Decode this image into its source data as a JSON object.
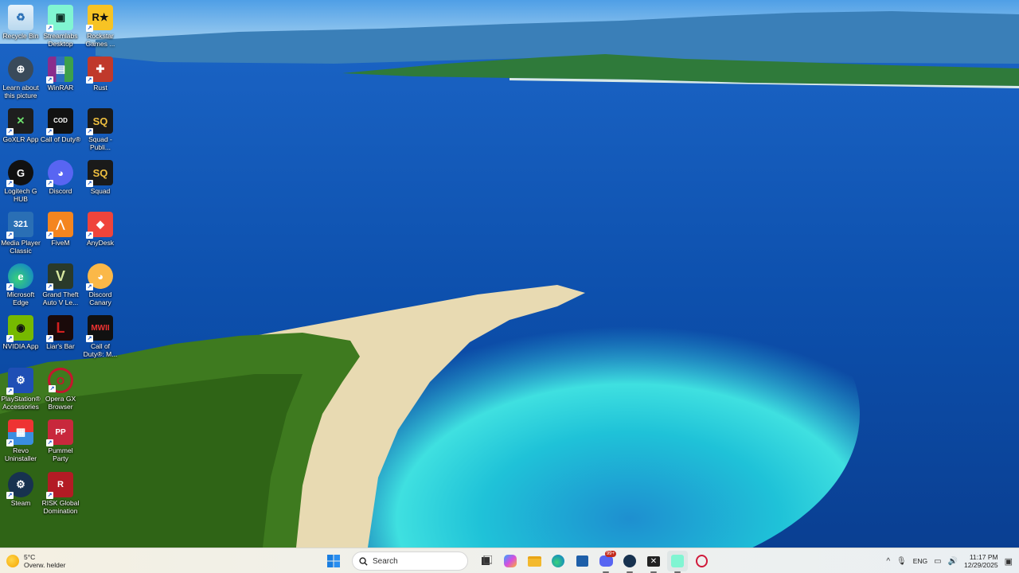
{
  "desktop": {
    "icons": [
      {
        "label": "Recycle Bin",
        "icon": "recycle-bin-icon"
      },
      {
        "label": "Streamlabs Desktop",
        "icon": "streamlabs-icon"
      },
      {
        "label": "Rockstar Games ...",
        "icon": "rockstar-icon"
      },
      {
        "label": "Learn about this picture",
        "icon": "learn-picture-icon"
      },
      {
        "label": "WinRAR",
        "icon": "winrar-icon"
      },
      {
        "label": "Rust",
        "icon": "rust-icon"
      },
      {
        "label": "GoXLR App",
        "icon": "goxlr-icon"
      },
      {
        "label": "Call of Duty®",
        "icon": "call-of-duty-icon"
      },
      {
        "label": "Squad - Publi...",
        "icon": "squad-public-icon"
      },
      {
        "label": "Logitech G HUB",
        "icon": "logitech-ghub-icon"
      },
      {
        "label": "Discord",
        "icon": "discord-icon"
      },
      {
        "label": "Squad",
        "icon": "squad-icon"
      },
      {
        "label": "Media Player Classic",
        "icon": "media-player-classic-icon"
      },
      {
        "label": "FiveM",
        "icon": "fivem-icon"
      },
      {
        "label": "AnyDesk",
        "icon": "anydesk-icon"
      },
      {
        "label": "Microsoft Edge",
        "icon": "edge-icon"
      },
      {
        "label": "Grand Theft Auto V Le...",
        "icon": "gta-v-icon"
      },
      {
        "label": "Discord Canary",
        "icon": "discord-canary-icon"
      },
      {
        "label": "NVIDIA App",
        "icon": "nvidia-icon"
      },
      {
        "label": "Liar's Bar",
        "icon": "liars-bar-icon"
      },
      {
        "label": "Call of Duty®: M...",
        "icon": "cod-mw-icon"
      },
      {
        "label": "PlayStation® Accessories",
        "icon": "playstation-accessories-icon"
      },
      {
        "label": "Opera GX Browser",
        "icon": "opera-gx-icon"
      },
      {
        "label": "Revo Uninstaller",
        "icon": "revo-uninstaller-icon"
      },
      {
        "label": "Pummel Party",
        "icon": "pummel-party-icon"
      },
      {
        "label": "Steam",
        "icon": "steam-icon"
      },
      {
        "label": "RISK Global Domination",
        "icon": "risk-icon"
      }
    ]
  },
  "taskbar": {
    "weather": {
      "temp": "5°C",
      "condition": "Overw. helder"
    },
    "search_placeholder": "Search",
    "apps": [
      {
        "name": "start-button",
        "icon": "windows-logo-icon"
      },
      {
        "name": "task-view",
        "icon": "task-view-icon"
      },
      {
        "name": "copilot",
        "icon": "copilot-icon"
      },
      {
        "name": "file-explorer",
        "icon": "folder-icon"
      },
      {
        "name": "edge",
        "icon": "edge-icon"
      },
      {
        "name": "store",
        "icon": "store-icon"
      },
      {
        "name": "discord",
        "icon": "discord-icon",
        "badge": "99+"
      },
      {
        "name": "steam",
        "icon": "steam-icon"
      },
      {
        "name": "goxlr",
        "icon": "goxlr-icon"
      },
      {
        "name": "streamlabs",
        "icon": "streamlabs-icon"
      },
      {
        "name": "opera",
        "icon": "opera-icon"
      }
    ],
    "tray": {
      "language": "ENG",
      "time": "11:17 PM",
      "date": "12/29/2025"
    }
  },
  "colors": {
    "sea": "#0a4fa8",
    "shallow": "#2fd0d8",
    "sand": "#e9dcb8",
    "forest": "#3f7a1e",
    "sky": "#6fb3ea"
  }
}
